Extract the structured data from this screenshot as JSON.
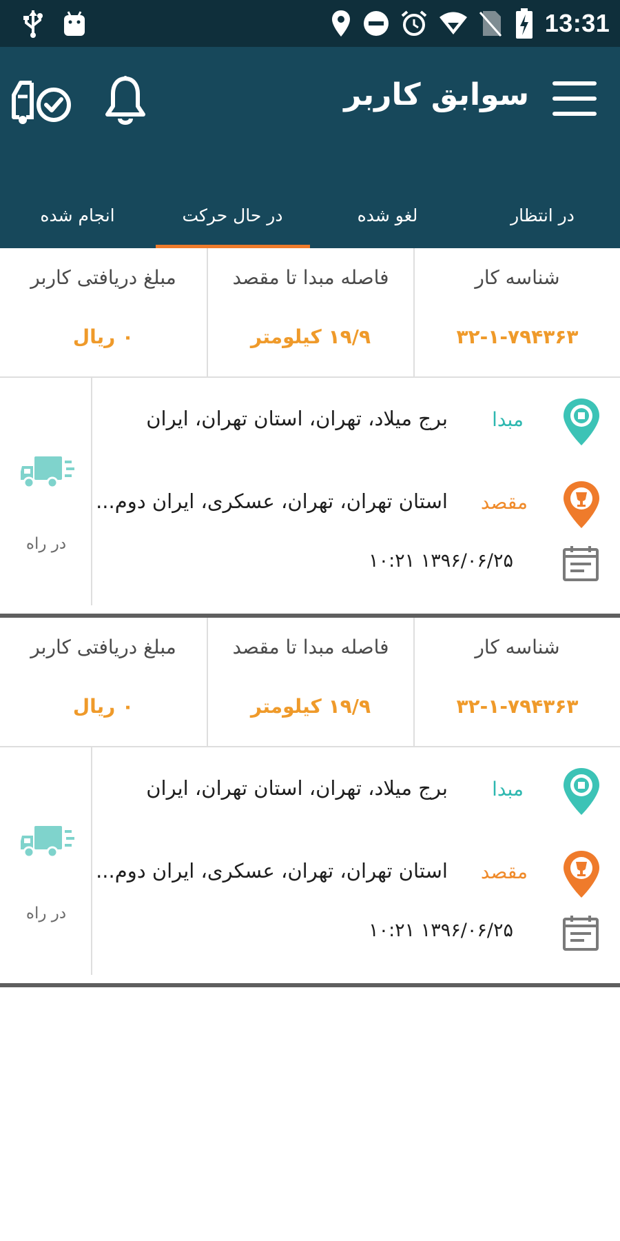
{
  "status_bar": {
    "time": "13:31",
    "icons": [
      "usb-icon",
      "android-icon",
      "location-icon",
      "do-not-disturb-icon",
      "alarm-icon",
      "wifi-icon",
      "no-sim-icon",
      "battery-charging-icon"
    ]
  },
  "app_bar": {
    "title": "سوابق کاربر",
    "icons": {
      "menu": "menu-icon",
      "bell": "bell-icon",
      "truck_check": "truck-check-icon"
    }
  },
  "tabs": [
    {
      "label": "در انتظار",
      "selected": false
    },
    {
      "label": "لغو شده",
      "selected": false
    },
    {
      "label": "در حال حرکت",
      "selected": true
    },
    {
      "label": "انجام شده",
      "selected": false
    }
  ],
  "colors": {
    "status_bar": "#0f2f3b",
    "app_bar": "#17485b",
    "accent": "#ef7b2b",
    "value": "#ef9a2a",
    "origin": "#2eb8b0",
    "destination": "#ef8a2a"
  },
  "cards": [
    {
      "summary": {
        "job_id_label": "شناسه کار",
        "job_id": "۳۲-۱-۷۹۴۳۶۳",
        "distance_label": "فاصله مبدا تا مقصد",
        "distance": "۱۹/۹ کیلومتر",
        "amount_label": "مبلغ دریافتی کاربر",
        "amount": "۰ ریال"
      },
      "origin_label": "مبدا",
      "origin": "برج میلاد، تهران، استان تهران، ایران",
      "destination_label": "مقصد",
      "destination": "استان تهران، تهران، عسکری، ایران دوم...",
      "datetime": "۱۳۹۶/۰۶/۲۵ ۱۰:۲۱",
      "status": "در راه"
    },
    {
      "summary": {
        "job_id_label": "شناسه کار",
        "job_id": "۳۲-۱-۷۹۴۳۶۳",
        "distance_label": "فاصله مبدا تا مقصد",
        "distance": "۱۹/۹ کیلومتر",
        "amount_label": "مبلغ دریافتی کاربر",
        "amount": "۰ ریال"
      },
      "origin_label": "مبدا",
      "origin": "برج میلاد، تهران، استان تهران، ایران",
      "destination_label": "مقصد",
      "destination": "استان تهران، تهران، عسکری، ایران دوم...",
      "datetime": "۱۳۹۶/۰۶/۲۵ ۱۰:۲۱",
      "status": "در راه"
    }
  ]
}
